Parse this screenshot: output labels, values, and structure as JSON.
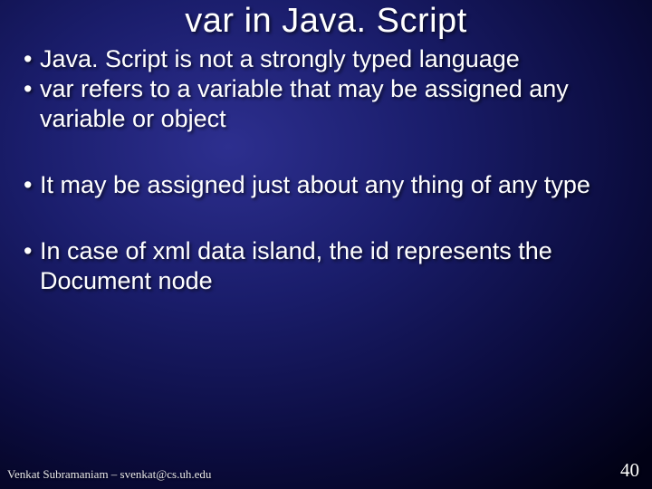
{
  "title": "var in Java. Script",
  "bullets": [
    "Java. Script is not a strongly typed language",
    "var refers to a variable that may be assigned any variable or object",
    "It may be assigned just about any thing of any type",
    "In case of xml data island, the id represents the Document node"
  ],
  "footer": {
    "author": "Venkat Subramaniam – svenkat@cs.uh.edu",
    "page": "40"
  }
}
